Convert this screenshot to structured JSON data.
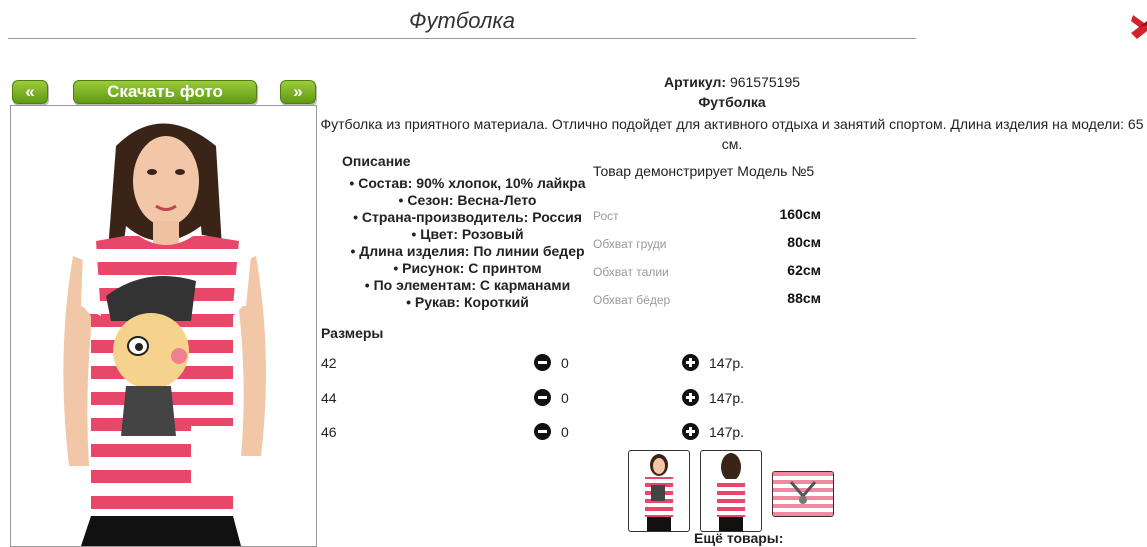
{
  "header": {
    "title": "Футболка"
  },
  "nav": {
    "prev_label": "«",
    "download_label": "Скачать фото",
    "next_label": "»"
  },
  "product": {
    "article_label": "Артикул:",
    "article_value": "961575195",
    "name": "Футболка",
    "summary": "Футболка из приятного материала. Отлично подойдет для активного отдыха и занятий спортом. Длина изделия на модели: 65 см."
  },
  "description": {
    "heading": "Описание",
    "items": [
      "Состав: 90% хлопок, 10% лайкра",
      "Сезон: Весна-Лето",
      "Страна-производитель: Россия",
      "Цвет: Розовый",
      "Длина изделия: По линии бедер",
      "Рисунок: С принтом",
      "По элементам: С карманами",
      "Рукав: Короткий"
    ]
  },
  "model": {
    "heading": "Товар демонстрирует Модель №5",
    "params": [
      {
        "label": "Рост",
        "value": "160см"
      },
      {
        "label": "Обхват груди",
        "value": "80см"
      },
      {
        "label": "Обхват талии",
        "value": "62см"
      },
      {
        "label": "Обхват бёдер",
        "value": "88см"
      }
    ]
  },
  "sizes": {
    "heading": "Размеры",
    "rows": [
      {
        "size": "42",
        "qty": "0",
        "price": "147р."
      },
      {
        "size": "44",
        "qty": "0",
        "price": "147р."
      },
      {
        "size": "46",
        "qty": "0",
        "price": "147р."
      }
    ]
  },
  "more_label": "Ещё товары:",
  "colors": {
    "accent_green": "#6aa71d",
    "stripe_pink": "#e8476a",
    "close_red": "#d0232b"
  }
}
